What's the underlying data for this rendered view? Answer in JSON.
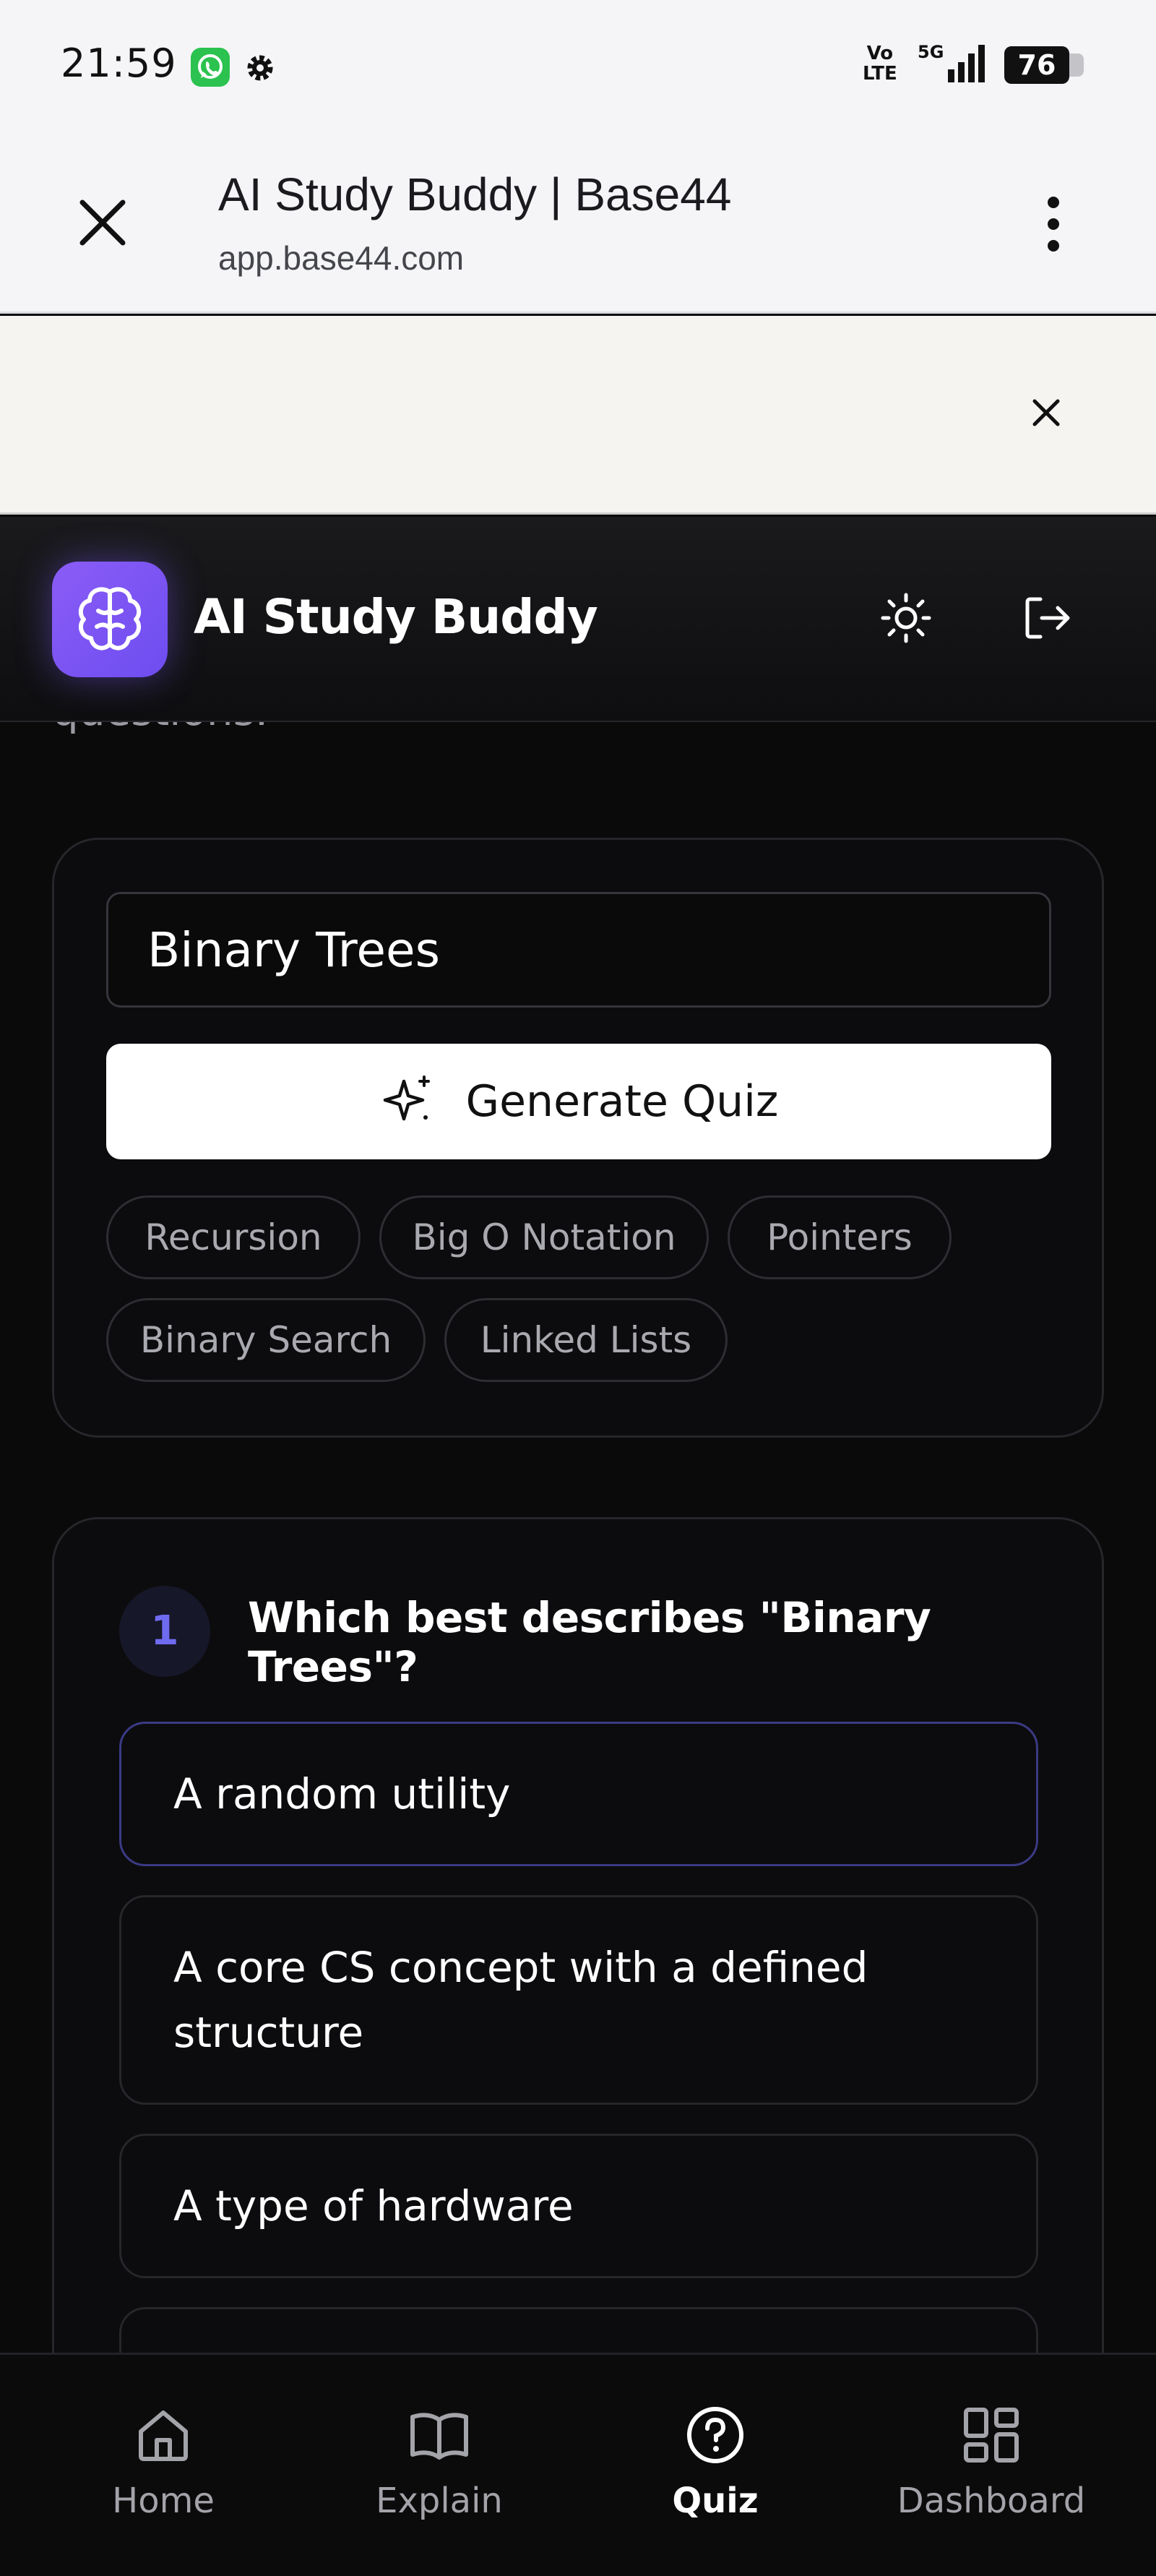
{
  "status_bar": {
    "time": "21:59",
    "volte": "Vo\nLTE",
    "network": "5G",
    "battery": "76"
  },
  "browser": {
    "title": "AI Study Buddy | Base44",
    "url": "app.base44.com"
  },
  "app": {
    "title": "AI Study Buddy"
  },
  "main": {
    "cut_text": "questions.",
    "topic_input": {
      "value": "Binary Trees",
      "placeholder": ""
    },
    "generate_label": "Generate Quiz",
    "chips": [
      "Recursion",
      "Big O Notation",
      "Pointers",
      "Binary Search",
      "Linked Lists"
    ]
  },
  "quiz": {
    "number": "1",
    "question": "Which best describes \"Binary Trees\"?",
    "options": [
      "A random utility",
      "A core CS concept with a defined structure",
      "A type of hardware",
      ""
    ]
  },
  "nav": [
    {
      "label": "Home",
      "icon": "home-icon"
    },
    {
      "label": "Explain",
      "icon": "book-icon"
    },
    {
      "label": "Quiz",
      "icon": "help-circle-icon"
    },
    {
      "label": "Dashboard",
      "icon": "grid-icon"
    }
  ],
  "colors": {
    "accent": "#8b5cf6",
    "selected_border": "#3b3a86",
    "background": "#0a0a0b"
  }
}
